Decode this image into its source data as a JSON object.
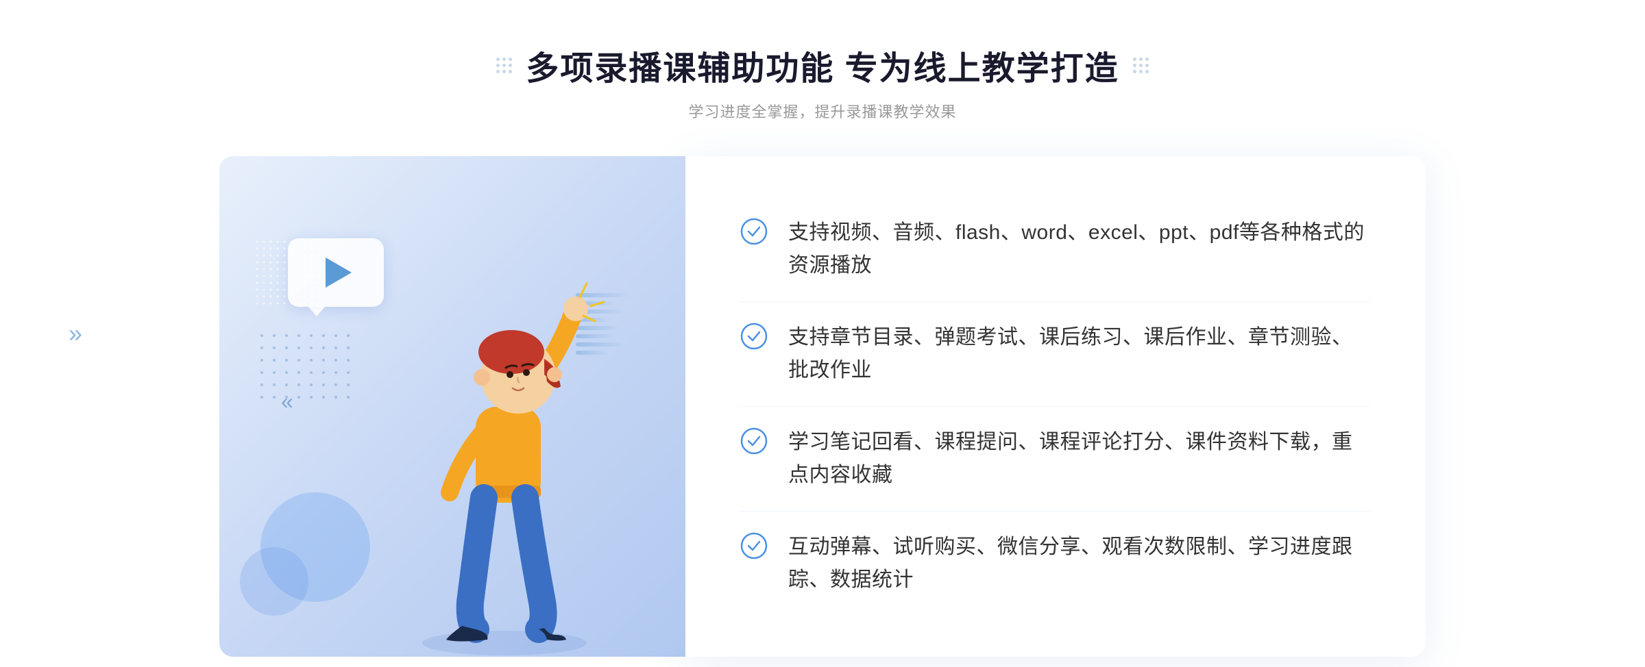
{
  "header": {
    "title": "多项录播课辅助功能 专为线上教学打造",
    "subtitle": "学习进度全掌握，提升录播课教学效果",
    "dots_decoration": true
  },
  "features": [
    {
      "id": 1,
      "text": "支持视频、音频、flash、word、excel、ppt、pdf等各种格式的资源播放"
    },
    {
      "id": 2,
      "text": "支持章节目录、弹题考试、课后练习、课后作业、章节测验、批改作业"
    },
    {
      "id": 3,
      "text": "学习笔记回看、课程提问、课程评论打分、课件资料下载，重点内容收藏"
    },
    {
      "id": 4,
      "text": "互动弹幕、试听购买、微信分享、观看次数限制、学习进度跟踪、数据统计"
    }
  ],
  "colors": {
    "primary_blue": "#4a90e2",
    "accent_blue": "#3b7bd4",
    "text_dark": "#1a1a2e",
    "text_gray": "#999999",
    "text_body": "#333333"
  },
  "chevron_left_symbol": "»",
  "play_icon": "▶"
}
